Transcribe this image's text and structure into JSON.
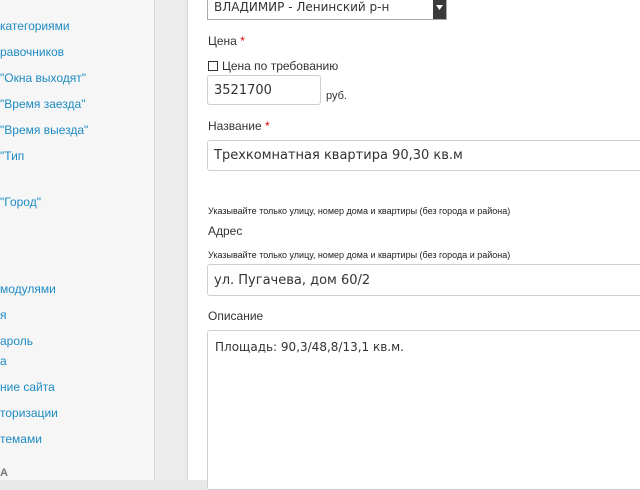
{
  "sidebar": {
    "items": [
      "категориями",
      "равочников",
      "\"Окна выходят\"",
      "\"Время заезда\"",
      "\"Время выезда\"",
      "\"Тип",
      "\"Город\"",
      "модулями",
      "я",
      "ароль",
      "а",
      "ние сайта",
      "торизации",
      "темами"
    ],
    "section_label": "А"
  },
  "form": {
    "region_select": {
      "value": "ВЛАДИМИР - Ленинский р-н"
    },
    "price": {
      "label": "Цена",
      "required_mark": "*",
      "on_request_label": "Цена по требованию",
      "value": "3521700",
      "unit": "руб."
    },
    "name": {
      "label": "Название",
      "required_mark": "*",
      "value": "Трехкомнатная квартира 90,30 кв.м"
    },
    "address": {
      "hint_top": "Указывайте только улицу, номер дома и квартиры (без города и района)",
      "label": "Адрес",
      "hint": "Указывайте только улицу, номер дома и квартиры (без города и района)",
      "value": "ул. Пугачева, дом 60/2"
    },
    "description": {
      "label": "Описание",
      "value": "Площадь: 90,3/48,8/13,1 кв.м."
    }
  }
}
